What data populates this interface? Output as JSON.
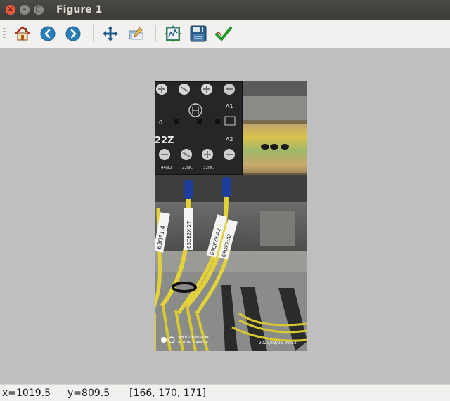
{
  "window": {
    "title": "Figure 1",
    "close_glyph": "×",
    "minimize_glyph": "–",
    "maximize_glyph": "□"
  },
  "toolbar": {
    "buttons": [
      {
        "name": "home",
        "icon": "home-icon"
      },
      {
        "name": "back",
        "icon": "back-arrow-icon"
      },
      {
        "name": "forward",
        "icon": "forward-arrow-icon"
      },
      {
        "name": "pan",
        "icon": "move-icon"
      },
      {
        "name": "zoom",
        "icon": "zoom-rect-icon"
      },
      {
        "name": "subplots",
        "icon": "subplots-icon"
      },
      {
        "name": "save",
        "icon": "floppy-icon"
      },
      {
        "name": "edit-axes",
        "icon": "checkmark-icon"
      }
    ]
  },
  "photo": {
    "relay_label": "22Z",
    "terminal_a1": "A1",
    "terminal_a2": "A2",
    "terminal_0": "0",
    "terminal_44no": "44NO",
    "terminal_22nc": "22NC",
    "terminal_32nc": "32NC",
    "sleeve_1": "63QF1:4",
    "sleeve_2": "63QE2X:2T",
    "sleeve_3": "63QF2X:A2",
    "sleeve_4": "63QF2:A2",
    "watermark_line1": "SHOT ON MI PLAY",
    "watermark_line2": "AI DUAL CAMERA",
    "timestamp": "2020/03/25 09:52"
  },
  "status": {
    "x": "x=1019.5",
    "y": "y=809.5",
    "pixel": "[166, 170, 171]"
  },
  "colors": {
    "titlebar": "#3c3b37",
    "toolbar": "#f2f1f0",
    "canvas": "#bfbfbf",
    "wire_yellow": "#e3d23a",
    "relay_black": "#262628"
  }
}
